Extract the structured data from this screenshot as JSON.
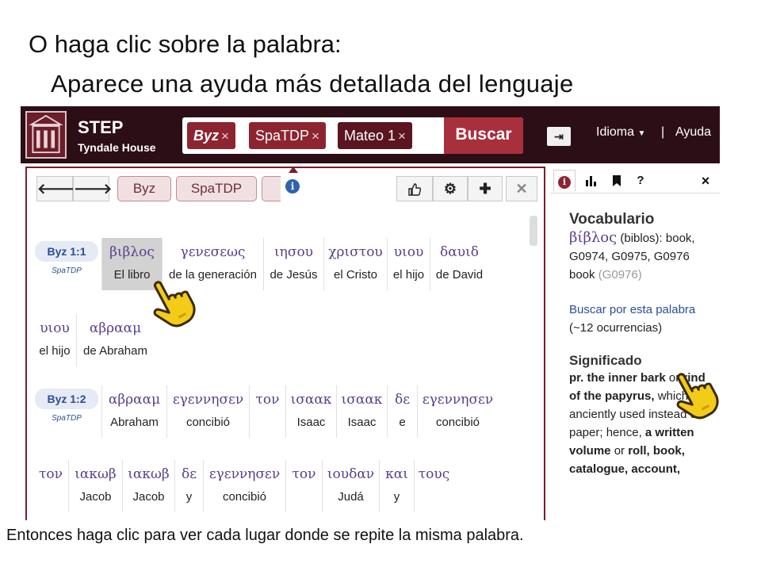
{
  "slide": {
    "title": "O haga clic sobre la palabra:",
    "subtitle": "Aparece una ayuda más detallada del lenguaje",
    "caption": "Entonces haga clic para ver cada lugar donde se repite la misma palabra."
  },
  "header": {
    "brand": "STEP",
    "brand_sub": "Tyndale House",
    "chips": [
      {
        "label": "Byz",
        "x": "×"
      },
      {
        "label": "SpaTDP",
        "x": "×"
      },
      {
        "label": "Mateo 1",
        "x": "×"
      }
    ],
    "search_label": "Buscar",
    "language_label": "Idioma",
    "separator": "|",
    "help_label": "Ayuda"
  },
  "toolbar": {
    "versions": [
      "Byz",
      "SpaTDP"
    ]
  },
  "passage": {
    "rows": [
      {
        "ref": "Byz 1:1",
        "ref_sub": "SpaTDP",
        "words": [
          {
            "greek": "βιβλος",
            "gloss": "El libro"
          },
          {
            "greek": "γενεσεως",
            "gloss": "de la generación"
          },
          {
            "greek": "ιησου",
            "gloss": "de Jesús"
          },
          {
            "greek": "χριστου",
            "gloss": "el Cristo"
          },
          {
            "greek": "υιου",
            "gloss": "el hijo"
          },
          {
            "greek": "δαυιδ",
            "gloss": "de David"
          }
        ]
      },
      {
        "ref": "",
        "ref_sub": "",
        "words": [
          {
            "greek": "υιου",
            "gloss": "el hijo"
          },
          {
            "greek": "αβρααμ",
            "gloss": "de Abraham"
          }
        ]
      },
      {
        "ref": "Byz 1:2",
        "ref_sub": "SpaTDP",
        "words": [
          {
            "greek": "αβρααμ",
            "gloss": "Abraham"
          },
          {
            "greek": "εγεννησεν",
            "gloss": "concibió"
          },
          {
            "greek": "τον",
            "gloss": ""
          },
          {
            "greek": "ισαακ",
            "gloss": "Isaac"
          },
          {
            "greek": "ισαακ",
            "gloss": "Isaac"
          },
          {
            "greek": "δε",
            "gloss": "e"
          },
          {
            "greek": "εγεννησεν",
            "gloss": "concibió"
          }
        ]
      },
      {
        "ref": "",
        "ref_sub": "",
        "words": [
          {
            "greek": "τον",
            "gloss": ""
          },
          {
            "greek": "ιακωβ",
            "gloss": "Jacob"
          },
          {
            "greek": "ιακωβ",
            "gloss": "Jacob"
          },
          {
            "greek": "δε",
            "gloss": "y"
          },
          {
            "greek": "εγεννησεν",
            "gloss": "concibió"
          },
          {
            "greek": "τον",
            "gloss": ""
          },
          {
            "greek": "ιουδαν",
            "gloss": "Judá"
          },
          {
            "greek": "και",
            "gloss": "y"
          },
          {
            "greek": "τους",
            "gloss": ""
          }
        ]
      }
    ]
  },
  "side": {
    "tab_help": "?",
    "tab_close": "×",
    "vocab_title": "Vocabulario",
    "lemma_greek": "βίβλος",
    "lemma_rest": "(biblos): book,",
    "strongs_line": "G0974, G0975, G0976",
    "book_word": "book",
    "book_code": "(G0976)",
    "search_link": "Buscar por esta palabra",
    "occurrences": "(~12 ocurrencias)",
    "meaning_title": "Significado",
    "def_pr": "pr.",
    "def_bold1": "the inner bark",
    "def_or": "or",
    "def_bold2": "rind of the papyrus,",
    "def_plain": "which was anciently used instead of paper; hence,",
    "def_bold3": "a written volume",
    "def_or2": "or",
    "def_bold4": "roll, book, catalogue, account,"
  },
  "colors": {
    "header_bg": "#2c0f16",
    "chip": "#8d2530",
    "accent": "#a8303c",
    "greek_text": "#5a3e8a",
    "link": "#2a4f94"
  }
}
